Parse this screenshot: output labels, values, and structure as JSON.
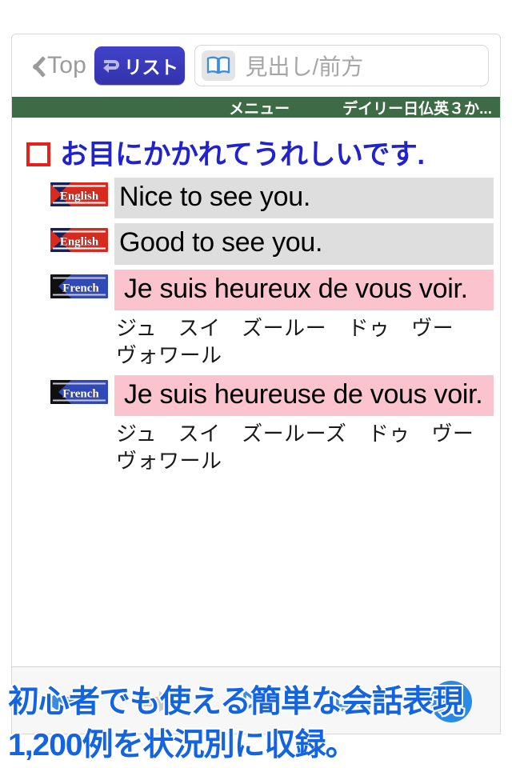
{
  "navbar": {
    "back_label": "Top",
    "list_button_label": "リスト",
    "search_placeholder": "見出し/前方",
    "search_value": ""
  },
  "menubar": {
    "menu_label": "メニュー",
    "dictionary_label": "デイリー日仏英３か..."
  },
  "entry": {
    "headword": "お目にかかれてうれしいです."
  },
  "translations": [
    {
      "badge": "English",
      "text": "Nice to see you.",
      "pron": ""
    },
    {
      "badge": "English",
      "text": "Good to see you.",
      "pron": ""
    },
    {
      "badge": "French",
      "text": "Je suis heureux de vous voir.",
      "pron": "ジュ　スイ　ズールー　ドゥ　ヴー　ヴォワール"
    },
    {
      "badge": "French",
      "text": "Je suis heureuse de vous voir.",
      "pron": "ジュ　スイ　ズールーズ　ドゥ　ヴー　ヴォワール"
    }
  ],
  "toolbar": {
    "items": [
      {
        "name": "back-arrow-icon",
        "label": ""
      },
      {
        "name": "forward-arrow-icon",
        "label": ""
      },
      {
        "name": "bookmark-icon",
        "label": ""
      },
      {
        "name": "history-icon",
        "label": ""
      },
      {
        "name": "help-icon",
        "label": "?"
      }
    ]
  },
  "ad": {
    "line1": "初心者でも使える簡単な会話表現",
    "line2": "1,200例を状況別に収録。"
  },
  "colors": {
    "green_bar": "#3d6b45",
    "headword_blue": "#2222cc",
    "bullet_red": "#e8201a",
    "english_row": "#dedede",
    "french_row": "#fbc3ce",
    "list_button": "#3b3bbf",
    "ad_blue": "#1464e0",
    "help_blue": "#2a8ae8"
  }
}
